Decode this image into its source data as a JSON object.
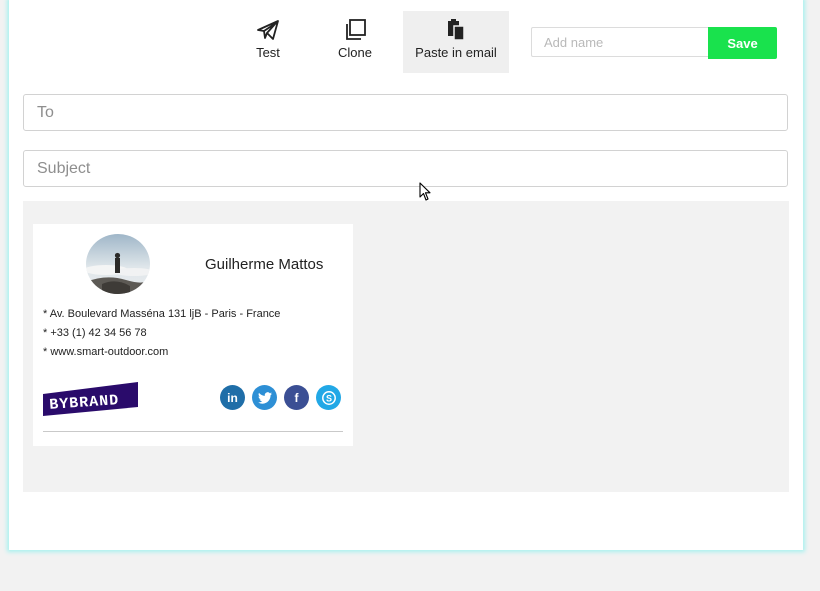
{
  "toolbar": {
    "test_label": "Test",
    "clone_label": "Clone",
    "paste_label": "Paste in email",
    "name_placeholder": "Add name",
    "save_label": "Save"
  },
  "compose": {
    "to_placeholder": "To",
    "subject_placeholder": "Subject"
  },
  "signature": {
    "name": "Guilherme Mattos",
    "address": "* Av. Boulevard Masséna 131 ljB - Paris - France",
    "phone": "* +33 (1) 42 34 56 78",
    "website": "* www.smart-outdoor.com",
    "logo_text": "BYBRAND",
    "social": [
      {
        "icon": "linkedin-icon",
        "glyph": "in",
        "color": "#1f6ea8"
      },
      {
        "icon": "twitter-icon",
        "glyph": "t",
        "color": "#2d8fd5"
      },
      {
        "icon": "facebook-icon",
        "glyph": "f",
        "color": "#3b4f94"
      },
      {
        "icon": "skype-icon",
        "glyph": "S",
        "color": "#22a8e6"
      }
    ]
  },
  "colors": {
    "accent": "#19e24d",
    "panel_glow": "#a8f1ef",
    "logo_bg": "#2a0b6b"
  }
}
